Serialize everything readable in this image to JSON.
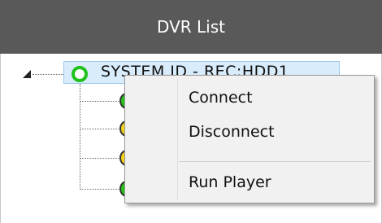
{
  "panel": {
    "title": "DVR List"
  },
  "tree": {
    "root": {
      "label": "SYSTEM ID - REC:HDD1",
      "icon": "status-ring-green-icon",
      "expanded": true,
      "selected": true
    },
    "children": [
      {
        "icon": "status-green-icon",
        "status_color": "#29c21a"
      },
      {
        "icon": "status-yellow-icon",
        "status_color": "#f3d31b"
      },
      {
        "icon": "status-yellow-icon",
        "status_color": "#f3d31b"
      },
      {
        "icon": "status-green-icon",
        "status_color": "#29c21a"
      }
    ]
  },
  "context_menu": {
    "items": [
      {
        "label": "Connect"
      },
      {
        "label": "Disconnect"
      },
      {
        "label": "Run Player"
      }
    ]
  },
  "colors": {
    "header_bg": "#595959",
    "header_text": "#ffffff",
    "selection_bg": "#d9ecfb",
    "menu_bg": "#f1f1f1"
  }
}
